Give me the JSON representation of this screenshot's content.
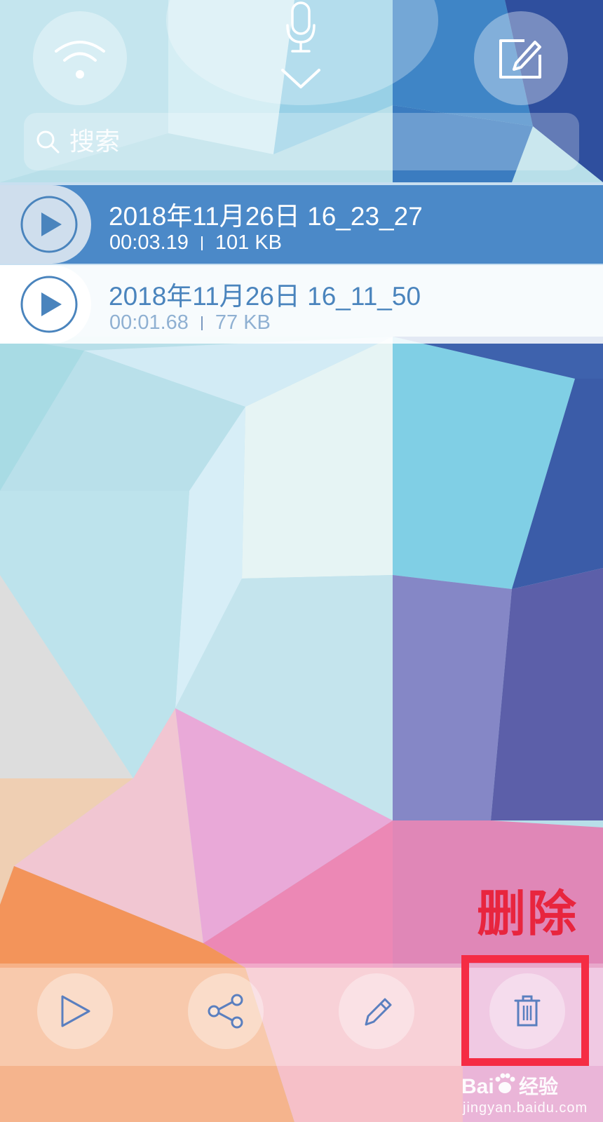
{
  "header": {
    "wifi_icon": "wifi-icon",
    "record_icon": "microphone-icon",
    "collapse_icon": "chevron-down-icon",
    "edit_icon": "edit-icon"
  },
  "search": {
    "placeholder": "搜索",
    "icon": "search-icon"
  },
  "recordings": [
    {
      "title": "2018年11月26日 16_23_27",
      "duration": "00:03.19",
      "size": "101 KB",
      "selected": true
    },
    {
      "title": "2018年11月26日 16_11_50",
      "duration": "00:01.68",
      "size": "77 KB",
      "selected": false
    }
  ],
  "toolbar": {
    "play_icon": "play-icon",
    "share_icon": "share-icon",
    "rename_icon": "pencil-icon",
    "delete_icon": "trash-icon"
  },
  "annotation": {
    "delete_caption": "删除",
    "color": "#f52c44"
  },
  "watermark": {
    "logo_text": "Baidu经验",
    "url": "jingyan.baidu.com"
  },
  "colors": {
    "selected_row": "#4b89c8",
    "accent_blue": "#4a84bd"
  }
}
